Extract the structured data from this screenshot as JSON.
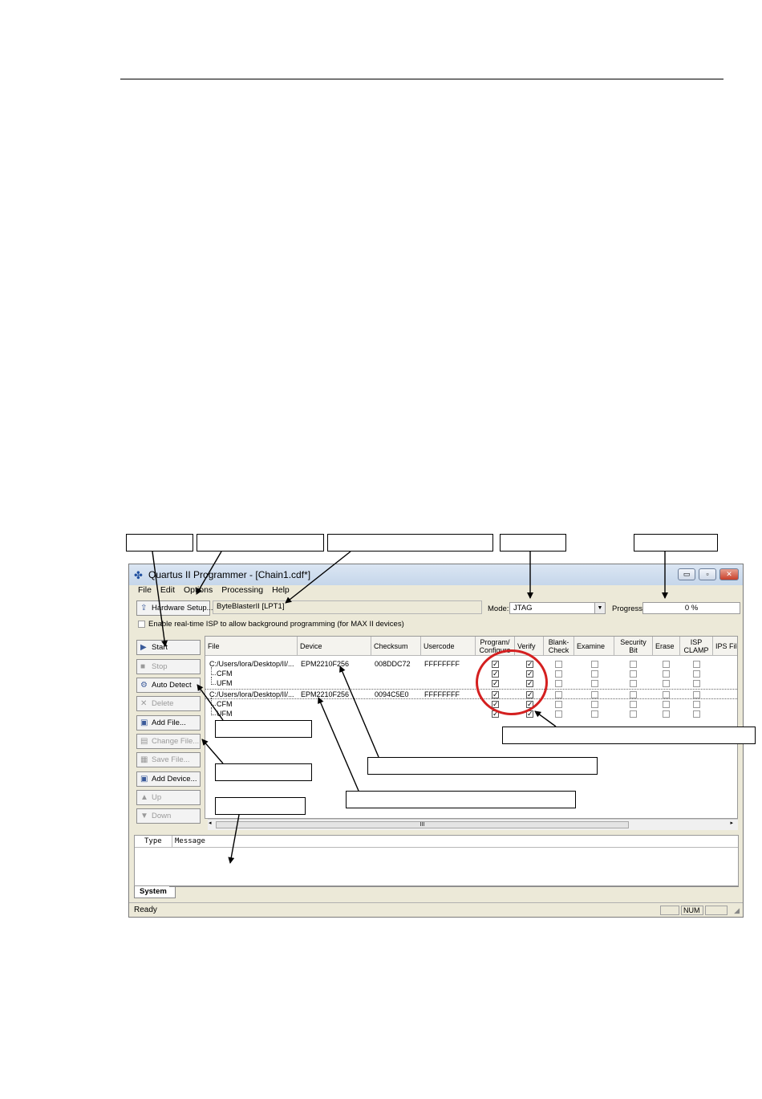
{
  "window": {
    "title": "Quartus II Programmer - [Chain1.cdf*]",
    "minimize_glyph": "▭",
    "restore_glyph": "▫",
    "close_glyph": "✕"
  },
  "menu": [
    "File",
    "Edit",
    "Options",
    "Processing",
    "Help"
  ],
  "toolbar": {
    "hardware_setup_label": "Hardware Setup...",
    "hardware_value": "ByteBlasterII [LPT1]",
    "mode_label": "Mode:",
    "mode_value": "JTAG",
    "progress_label": "Progress:",
    "progress_value": "0 %",
    "realtime_isp_label": "Enable real-time ISP to allow background programming (for MAX II devices)"
  },
  "side_buttons": [
    {
      "label": "Start",
      "icon": "start-icon",
      "enabled": true
    },
    {
      "label": "Stop",
      "icon": "stop-icon",
      "enabled": false
    },
    {
      "label": "Auto Detect",
      "icon": "auto-detect-icon",
      "enabled": true
    },
    {
      "label": "Delete",
      "icon": "delete-icon",
      "enabled": false
    },
    {
      "label": "Add File...",
      "icon": "add-file-icon",
      "enabled": true
    },
    {
      "label": "Change File...",
      "icon": "change-file-icon",
      "enabled": false
    },
    {
      "label": "Save File...",
      "icon": "save-file-icon",
      "enabled": false
    },
    {
      "label": "Add Device...",
      "icon": "add-device-icon",
      "enabled": true
    },
    {
      "label": "Up",
      "icon": "up-icon",
      "enabled": false
    },
    {
      "label": "Down",
      "icon": "down-icon",
      "enabled": false
    }
  ],
  "grid": {
    "columns": [
      "File",
      "Device",
      "Checksum",
      "Usercode",
      "Program/\nConfigure",
      "Verify",
      "Blank-\nCheck",
      "Examine",
      "Security\nBit",
      "Erase",
      "ISP\nCLAMP",
      "IPS File"
    ],
    "rows": [
      {
        "file": "C:/Users/lora/Desktop/II/...",
        "device": "EPM2210F256",
        "checksum": "008DDC72",
        "usercode": "FFFFFFFF",
        "checks": [
          true,
          true,
          false,
          false,
          false,
          false,
          false
        ]
      },
      {
        "file": "CFM",
        "device": "",
        "checksum": "",
        "usercode": "",
        "checks": [
          true,
          true,
          false,
          false,
          false,
          false,
          false
        ]
      },
      {
        "file": "UFM",
        "device": "",
        "checksum": "",
        "usercode": "",
        "checks": [
          true,
          true,
          false,
          false,
          false,
          false,
          false
        ]
      },
      {
        "file": "C:/Users/lora/Desktop/II/...",
        "device": "EPM2210F256",
        "checksum": "0094C5E0",
        "usercode": "FFFFFFFF",
        "checks": [
          true,
          true,
          false,
          false,
          false,
          false,
          false
        ]
      },
      {
        "file": "CFM",
        "device": "",
        "checksum": "",
        "usercode": "",
        "checks": [
          true,
          true,
          false,
          false,
          false,
          false,
          false
        ]
      },
      {
        "file": "UFM",
        "device": "",
        "checksum": "",
        "usercode": "",
        "checks": [
          true,
          true,
          false,
          false,
          false,
          false,
          false
        ]
      }
    ]
  },
  "messages": {
    "type_header": "Type",
    "message_header": "Message",
    "tab_label": "System"
  },
  "status": {
    "text": "Ready",
    "num": "NUM"
  },
  "scroll_glyph": "III",
  "colors": {
    "annotation_circle": "#d42020",
    "window_bg": "#ece9d8"
  }
}
